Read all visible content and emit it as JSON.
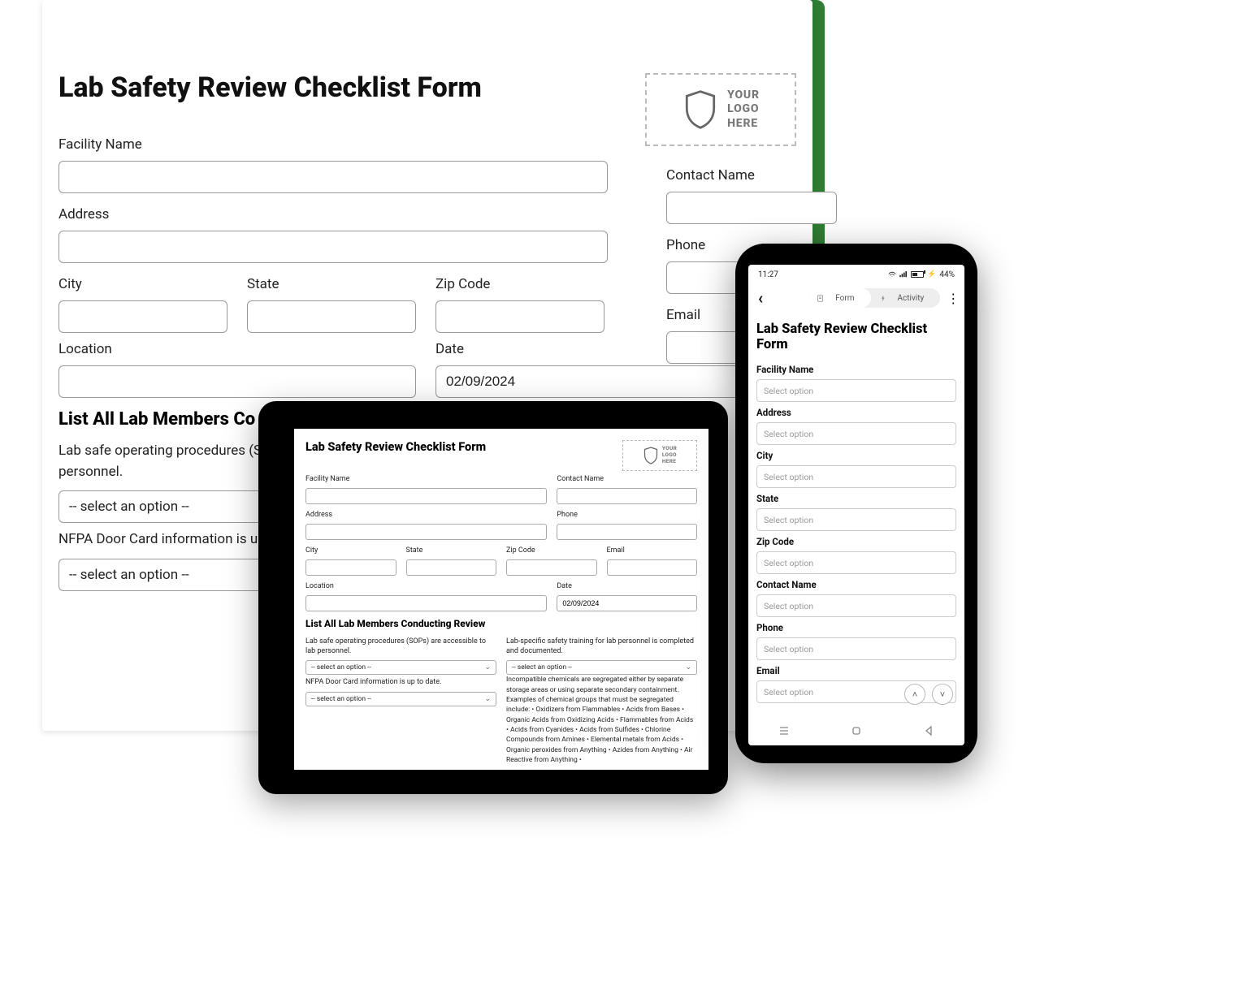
{
  "form_title": "Lab Safety Review Checklist Form",
  "logo_placeholder": "YOUR\nLOGO\nHERE",
  "fields": {
    "facility_name": "Facility Name",
    "contact_name": "Contact Name",
    "address": "Address",
    "phone": "Phone",
    "city": "City",
    "state": "State",
    "zip_code": "Zip Code",
    "email": "Email",
    "location": "Location",
    "date": "Date"
  },
  "date_value": "02/09/2024",
  "section_members": "List All Lab Members Conducting Review",
  "section_members_truncated": "List All Lab Members Co",
  "select_placeholder": "-- select an option --",
  "mobile_select_placeholder": "Select option",
  "questions": {
    "sops": "Lab safe operating procedures (SOPs) are accessible to lab personnel.",
    "sops_truncated": "Lab safe operating procedures (SOPs",
    "sops_truncated_line2": "personnel.",
    "nfpa": "NFPA Door Card information is up to date.",
    "nfpa_truncated": "NFPA Door Card information is up to",
    "training": "Lab-specific safety training for lab personnel is completed and documented.",
    "segregation": "Incompatible chemicals are segregated either by separate storage areas or using separate secondary containment. Examples of chemical groups that must be segregated include: • Oxidizers from Flammables • Acids from Bases • Organic Acids from Oxidizing Acids • Flammables from Acids • Acids from Cyanides • Acids from Sulfides • Chlorine Compounds from Amines • Elemental metals from Acids • Organic peroxides from Anything • Azides from Anything • Air Reactive from Anything •"
  },
  "phone": {
    "status_time": "11:27",
    "battery_pct": "44%",
    "seg_form": "Form",
    "seg_activity": "Activity",
    "field_order": [
      "Facility Name",
      "Address",
      "City",
      "State",
      "Zip Code",
      "Contact Name",
      "Phone",
      "Email"
    ]
  }
}
